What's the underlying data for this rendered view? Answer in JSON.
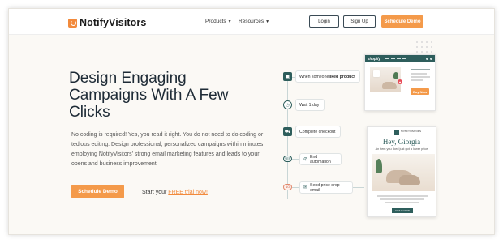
{
  "header": {
    "logo_text": "NotifyVisitors",
    "menu": [
      {
        "label": "Products"
      },
      {
        "label": "Resources"
      }
    ],
    "login_label": "Login",
    "signup_label": "Sign Up",
    "demo_label": "Schedule Demo"
  },
  "hero": {
    "headline": "Design Engaging Campaigns With A Few Clicks",
    "description": "No coding is required! Yes, you read it right. You do not need to do coding or tedious editing. Design professional, personalized campaigns within minutes employing NotifyVisitors' strong email marketing features and leads to your opens and business improvement.",
    "cta_label": "Schedule Demo",
    "trial_prefix": "Start your ",
    "trial_link": "FREE trial now!"
  },
  "workflow": {
    "steps": [
      {
        "prefix": "When someone ",
        "bold": "liked product",
        "icon": "bag-icon"
      },
      {
        "label": "Wait 1 day",
        "icon": "timer-icon"
      },
      {
        "label": "Complete checkout",
        "icon": "cart-icon"
      },
      {
        "label": "End automation",
        "icon": "stop-icon",
        "tag": "YES"
      },
      {
        "label": "Send price drop email",
        "icon": "mail-icon",
        "tag": "NO"
      }
    ]
  },
  "shop_card": {
    "brand": "shopify",
    "buy_label": "Buy Now"
  },
  "email_card": {
    "brand": "NOTIFYVISITORS",
    "greeting": "Hey, Giorgia",
    "subtitle": "An item you liked just got a lower price",
    "button": "GET IT NOW"
  },
  "colors": {
    "accent": "#f49a4a",
    "teal": "#2e5e5c",
    "background": "#fbf9f5"
  }
}
